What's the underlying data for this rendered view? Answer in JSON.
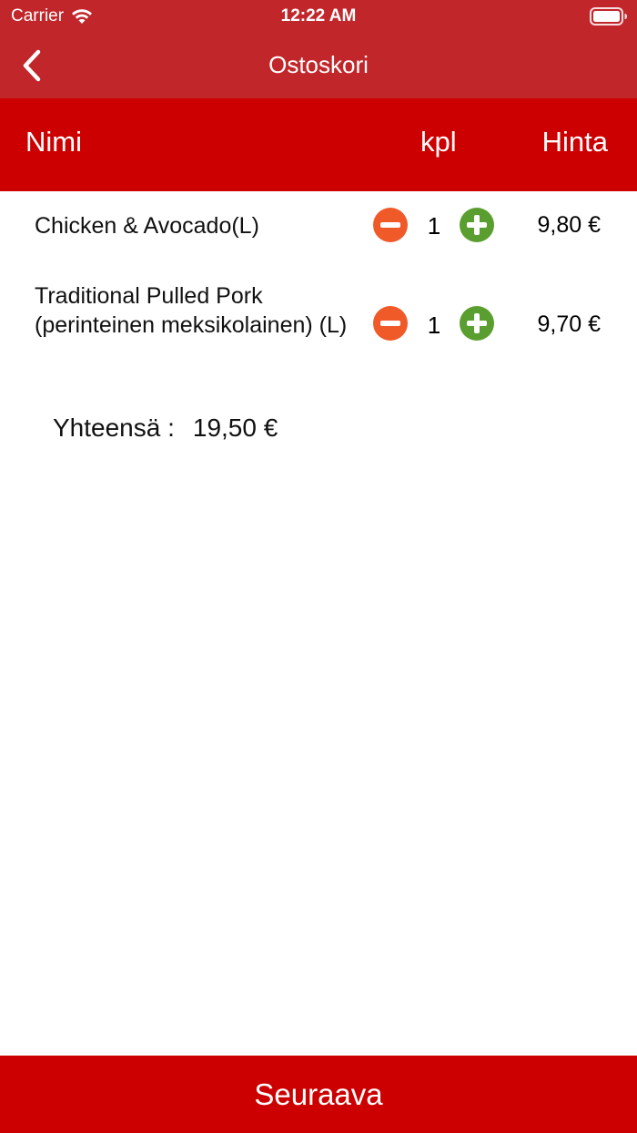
{
  "status_bar": {
    "carrier": "Carrier",
    "time": "12:22 AM",
    "icons": [
      "wifi-icon",
      "battery-icon"
    ]
  },
  "nav": {
    "title": "Ostoskori",
    "back_icon": "chevron-left-icon"
  },
  "columns": {
    "name": "Nimi",
    "qty": "kpl",
    "price": "Hinta"
  },
  "items": [
    {
      "name": "Chicken & Avocado(L)",
      "qty": "1",
      "price": "9,80 €"
    },
    {
      "name": "Traditional Pulled Pork (perinteinen meksikolainen) (L)",
      "qty": "1",
      "price": "9,70 €"
    }
  ],
  "total": {
    "label": "Yhteensä :",
    "value": "19,50 €"
  },
  "next_button": "Seuraava",
  "colors": {
    "nav_bar": "#c1262a",
    "header_band": "#cc0000",
    "minus": "#f05a28",
    "plus": "#5a9e2f"
  }
}
